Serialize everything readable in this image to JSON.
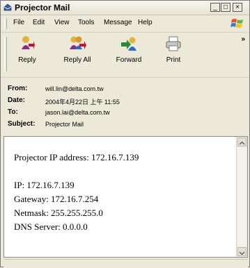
{
  "window": {
    "title": "Projector Mail",
    "minimize": "_",
    "maximize": "□",
    "close": "×"
  },
  "menu": {
    "file": "File",
    "edit": "Edit",
    "view": "View",
    "tools": "Tools",
    "message": "Message",
    "help": "Help"
  },
  "toolbar": {
    "reply": "Reply",
    "reply_all": "Reply All",
    "forward": "Forward",
    "print": "Print",
    "more": "»"
  },
  "headers": {
    "from_label": "From:",
    "from_value": "will.lin@delta.com.tw",
    "date_label": "Date:",
    "date_value": "2004年4月22日 上午 11:55",
    "to_label": "To:",
    "to_value": "jason.lai@delta.com.tw",
    "subject_label": "Subject:",
    "subject_value": "Projector Mail"
  },
  "body": {
    "line1": "Projector IP address: 172.16.7.139",
    "line2": "IP: 172.16.7.139",
    "line3": "Gateway: 172.16.7.254",
    "line4": "Netmask: 255.255.255.0",
    "line5": "DNS Server: 0.0.0.0"
  }
}
